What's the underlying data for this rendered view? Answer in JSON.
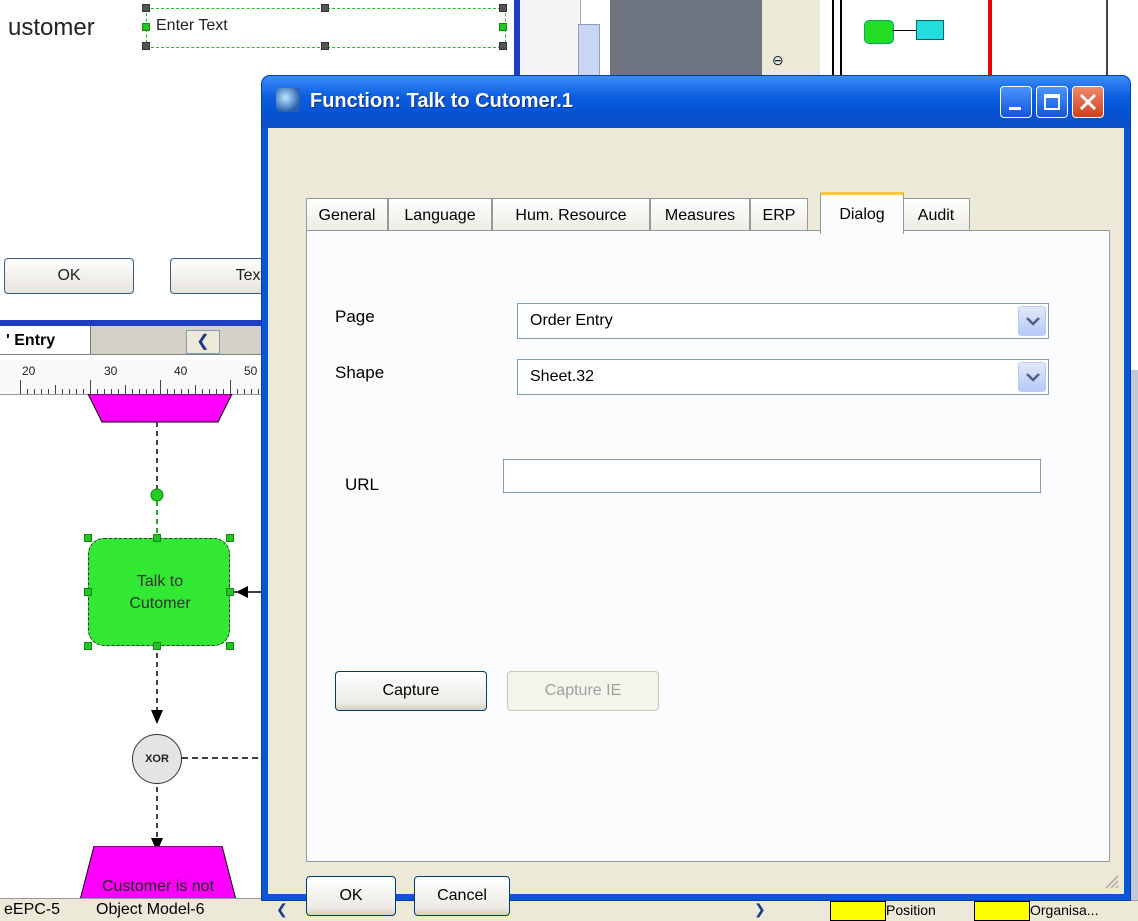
{
  "background": {
    "title_fragment": "ustomer",
    "enter_text": "Enter Text",
    "ok_label": "OK",
    "text_label": "Text",
    "tab_label": "' Entry",
    "ruler_labels": [
      "20",
      "30",
      "40",
      "50"
    ],
    "shape_label": "Talk to\nCutomer",
    "xor_label": "XOR",
    "bottom_shape_label": "Customer is not",
    "bottom_tabs": [
      "eEPC-5",
      "Object Model-6"
    ],
    "legend_items": [
      "Position",
      "Organisa..."
    ]
  },
  "dialog": {
    "title": "Function: Talk to Cutomer.1",
    "tabs": [
      "General",
      "Language",
      "Hum. Resource",
      "Measures",
      "ERP",
      "Dialog",
      "Audit"
    ],
    "active_tab": "Dialog",
    "page_label": "Page",
    "page_value": "Order Entry",
    "shape_label": "Shape",
    "shape_value": "Sheet.32",
    "url_label": "URL",
    "url_value": "",
    "capture_label": "Capture",
    "capture_ie_label": "Capture IE",
    "ok_label": "OK",
    "cancel_label": "Cancel"
  },
  "colors": {
    "titlebar": "#0a56d6",
    "function_shape": "#33e833",
    "event_shape": "#ff00ff",
    "selection_handle": "#22c322",
    "active_tab_accent": "#ffc83c"
  }
}
